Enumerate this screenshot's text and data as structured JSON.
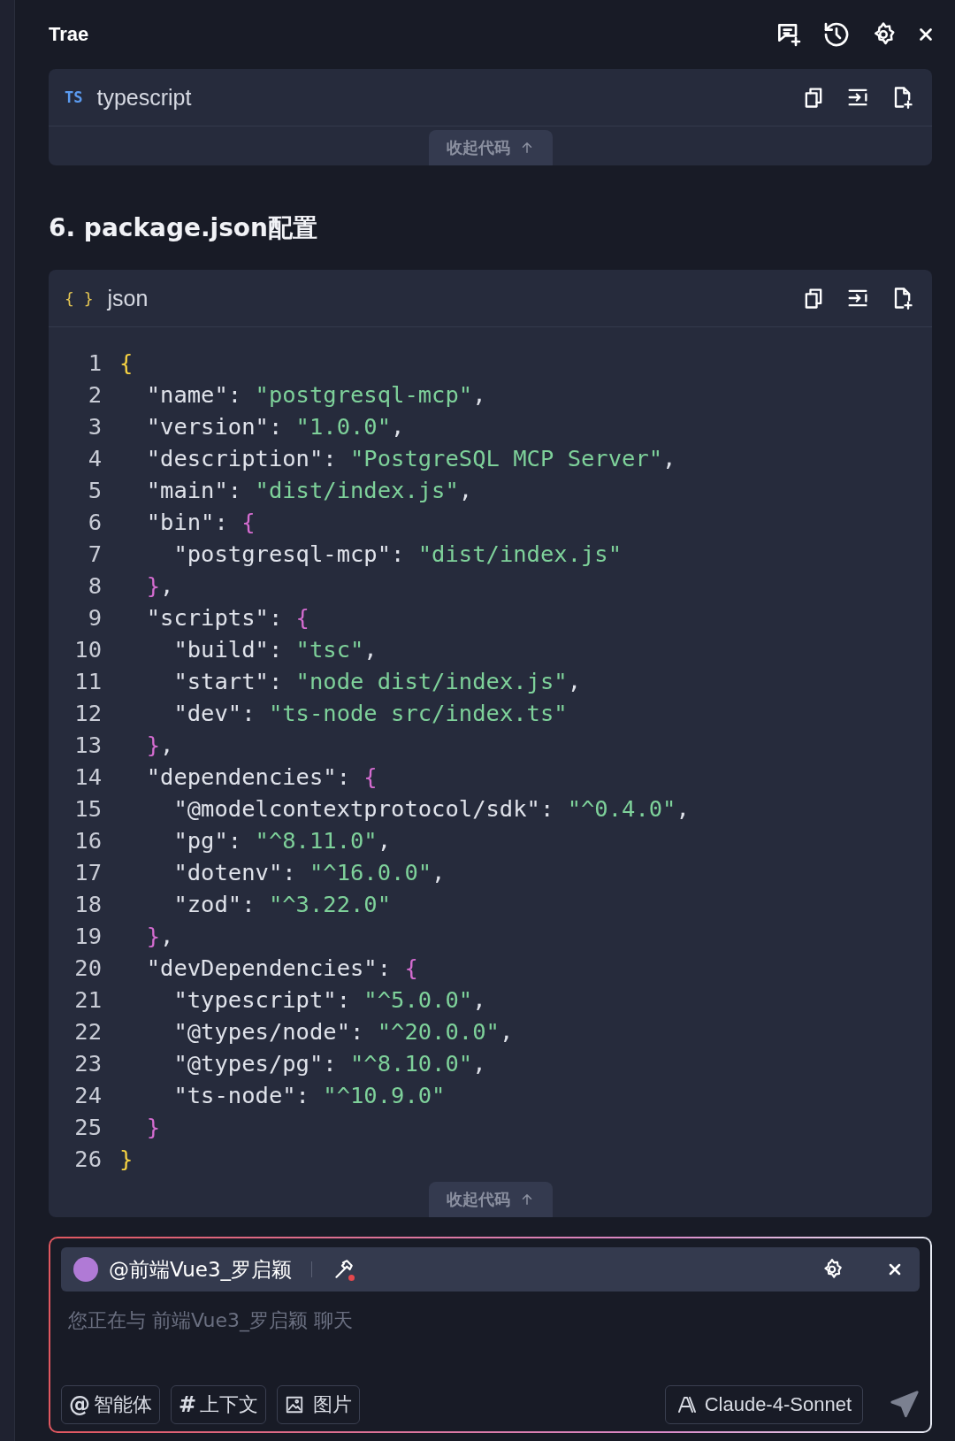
{
  "window": {
    "title": "Trae"
  },
  "blocks": [
    {
      "kind": "collapsed",
      "lang_badge": "TS",
      "language": "typescript",
      "collapse_label": "收起代码"
    },
    {
      "kind": "heading",
      "text": "6. package.json配置"
    },
    {
      "kind": "code",
      "lang_badge": "{ }",
      "language": "json",
      "collapse_label": "收起代码",
      "lines": [
        {
          "number": "1",
          "tokens": [
            {
              "text": "{",
              "kind": "brace1"
            }
          ]
        },
        {
          "number": "2",
          "tokens": [
            {
              "text": "  \"name\": ",
              "kind": "plain"
            },
            {
              "text": "\"postgresql-mcp\"",
              "kind": "string"
            },
            {
              "text": ",",
              "kind": "plain"
            }
          ]
        },
        {
          "number": "3",
          "tokens": [
            {
              "text": "  \"version\": ",
              "kind": "plain"
            },
            {
              "text": "\"1.0.0\"",
              "kind": "string"
            },
            {
              "text": ",",
              "kind": "plain"
            }
          ]
        },
        {
          "number": "4",
          "tokens": [
            {
              "text": "  \"description\": ",
              "kind": "plain"
            },
            {
              "text": "\"PostgreSQL MCP Server\"",
              "kind": "string"
            },
            {
              "text": ",",
              "kind": "plain"
            }
          ]
        },
        {
          "number": "5",
          "tokens": [
            {
              "text": "  \"main\": ",
              "kind": "plain"
            },
            {
              "text": "\"dist/index.js\"",
              "kind": "string"
            },
            {
              "text": ",",
              "kind": "plain"
            }
          ]
        },
        {
          "number": "6",
          "tokens": [
            {
              "text": "  \"bin\": ",
              "kind": "plain"
            },
            {
              "text": "{",
              "kind": "brace2"
            }
          ]
        },
        {
          "number": "7",
          "tokens": [
            {
              "text": "    \"postgresql-mcp\": ",
              "kind": "plain"
            },
            {
              "text": "\"dist/index.js\"",
              "kind": "string"
            }
          ]
        },
        {
          "number": "8",
          "tokens": [
            {
              "text": "  }",
              "kind": "brace2"
            },
            {
              "text": ",",
              "kind": "plain"
            }
          ]
        },
        {
          "number": "9",
          "tokens": [
            {
              "text": "  \"scripts\": ",
              "kind": "plain"
            },
            {
              "text": "{",
              "kind": "brace2"
            }
          ]
        },
        {
          "number": "10",
          "tokens": [
            {
              "text": "    \"build\": ",
              "kind": "plain"
            },
            {
              "text": "\"tsc\"",
              "kind": "string"
            },
            {
              "text": ",",
              "kind": "plain"
            }
          ]
        },
        {
          "number": "11",
          "tokens": [
            {
              "text": "    \"start\": ",
              "kind": "plain"
            },
            {
              "text": "\"node dist/index.js\"",
              "kind": "string"
            },
            {
              "text": ",",
              "kind": "plain"
            }
          ]
        },
        {
          "number": "12",
          "tokens": [
            {
              "text": "    \"dev\": ",
              "kind": "plain"
            },
            {
              "text": "\"ts-node src/index.ts\"",
              "kind": "string"
            }
          ]
        },
        {
          "number": "13",
          "tokens": [
            {
              "text": "  }",
              "kind": "brace2"
            },
            {
              "text": ",",
              "kind": "plain"
            }
          ]
        },
        {
          "number": "14",
          "tokens": [
            {
              "text": "  \"dependencies\": ",
              "kind": "plain"
            },
            {
              "text": "{",
              "kind": "brace2"
            }
          ]
        },
        {
          "number": "15",
          "tokens": [
            {
              "text": "    \"@modelcontextprotocol/sdk\": ",
              "kind": "plain"
            },
            {
              "text": "\"^0.4.0\"",
              "kind": "string"
            },
            {
              "text": ",",
              "kind": "plain"
            }
          ]
        },
        {
          "number": "16",
          "tokens": [
            {
              "text": "    \"pg\": ",
              "kind": "plain"
            },
            {
              "text": "\"^8.11.0\"",
              "kind": "string"
            },
            {
              "text": ",",
              "kind": "plain"
            }
          ]
        },
        {
          "number": "17",
          "tokens": [
            {
              "text": "    \"dotenv\": ",
              "kind": "plain"
            },
            {
              "text": "\"^16.0.0\"",
              "kind": "string"
            },
            {
              "text": ",",
              "kind": "plain"
            }
          ]
        },
        {
          "number": "18",
          "tokens": [
            {
              "text": "    \"zod\": ",
              "kind": "plain"
            },
            {
              "text": "\"^3.22.0\"",
              "kind": "string"
            }
          ]
        },
        {
          "number": "19",
          "tokens": [
            {
              "text": "  }",
              "kind": "brace2"
            },
            {
              "text": ",",
              "kind": "plain"
            }
          ]
        },
        {
          "number": "20",
          "tokens": [
            {
              "text": "  \"devDependencies\": ",
              "kind": "plain"
            },
            {
              "text": "{",
              "kind": "brace2"
            }
          ]
        },
        {
          "number": "21",
          "tokens": [
            {
              "text": "    \"typescript\": ",
              "kind": "plain"
            },
            {
              "text": "\"^5.0.0\"",
              "kind": "string"
            },
            {
              "text": ",",
              "kind": "plain"
            }
          ]
        },
        {
          "number": "22",
          "tokens": [
            {
              "text": "    \"@types/node\": ",
              "kind": "plain"
            },
            {
              "text": "\"^20.0.0\"",
              "kind": "string"
            },
            {
              "text": ",",
              "kind": "plain"
            }
          ]
        },
        {
          "number": "23",
          "tokens": [
            {
              "text": "    \"@types/pg\": ",
              "kind": "plain"
            },
            {
              "text": "\"^8.10.0\"",
              "kind": "string"
            },
            {
              "text": ",",
              "kind": "plain"
            }
          ]
        },
        {
          "number": "24",
          "tokens": [
            {
              "text": "    \"ts-node\": ",
              "kind": "plain"
            },
            {
              "text": "\"^10.9.0\"",
              "kind": "string"
            }
          ]
        },
        {
          "number": "25",
          "tokens": [
            {
              "text": "  }",
              "kind": "brace2"
            }
          ]
        },
        {
          "number": "26",
          "tokens": [
            {
              "text": "}",
              "kind": "brace1"
            }
          ]
        }
      ]
    }
  ],
  "chat_input": {
    "agent": "@前端Vue3_罗启颖",
    "placeholder": "您正在与 前端Vue3_罗启颖 聊天",
    "chips": [
      "智能体",
      "上下文",
      "图片"
    ],
    "chip_icons": [
      "@",
      "#"
    ],
    "model": "Claude-4-Sonnet"
  }
}
